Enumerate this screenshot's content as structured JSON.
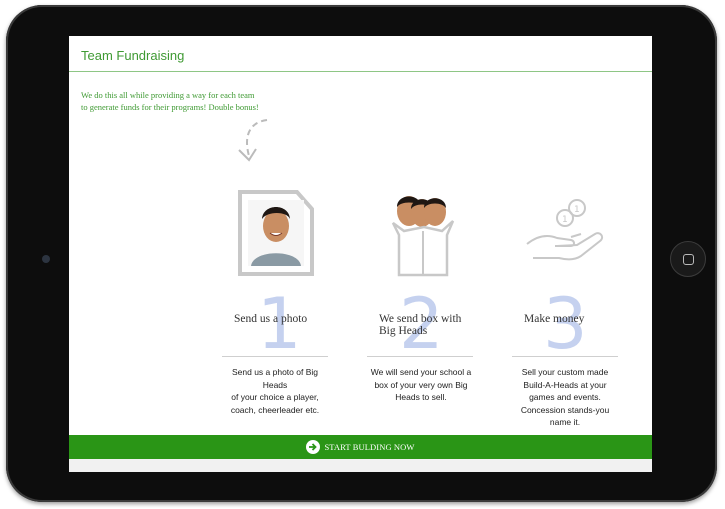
{
  "header": {
    "title": "Team Fundraising"
  },
  "intro": {
    "lines": [
      "We do this all while providing a way for each team",
      "to generate funds for their programs! Double bonus!"
    ]
  },
  "steps": [
    {
      "number": "1",
      "title_lines": [
        "Send us a photo"
      ],
      "desc_lines": [
        "Send us a photo of Big Heads",
        "of your choice a player,",
        "coach, cheerleader etc."
      ],
      "icon": "photo-icon"
    },
    {
      "number": "2",
      "title_lines": [
        "We send box with",
        "Big Heads"
      ],
      "desc_lines": [
        "We will send your school a",
        "box of your very own Big",
        "Heads to sell."
      ],
      "icon": "box-icon"
    },
    {
      "number": "3",
      "title_lines": [
        "Make money"
      ],
      "desc_lines": [
        "Sell your custom made",
        "Build-A-Heads at your",
        "games and events.",
        "Concession stands-you",
        "name it."
      ],
      "icon": "money-hand-icon"
    }
  ],
  "cta": {
    "label": "START BULDING NOW",
    "icon": "arrow-right-circle-icon",
    "color": "#2a9516"
  },
  "colors": {
    "accent": "#3f9a33",
    "number": "#c5d1ef"
  }
}
